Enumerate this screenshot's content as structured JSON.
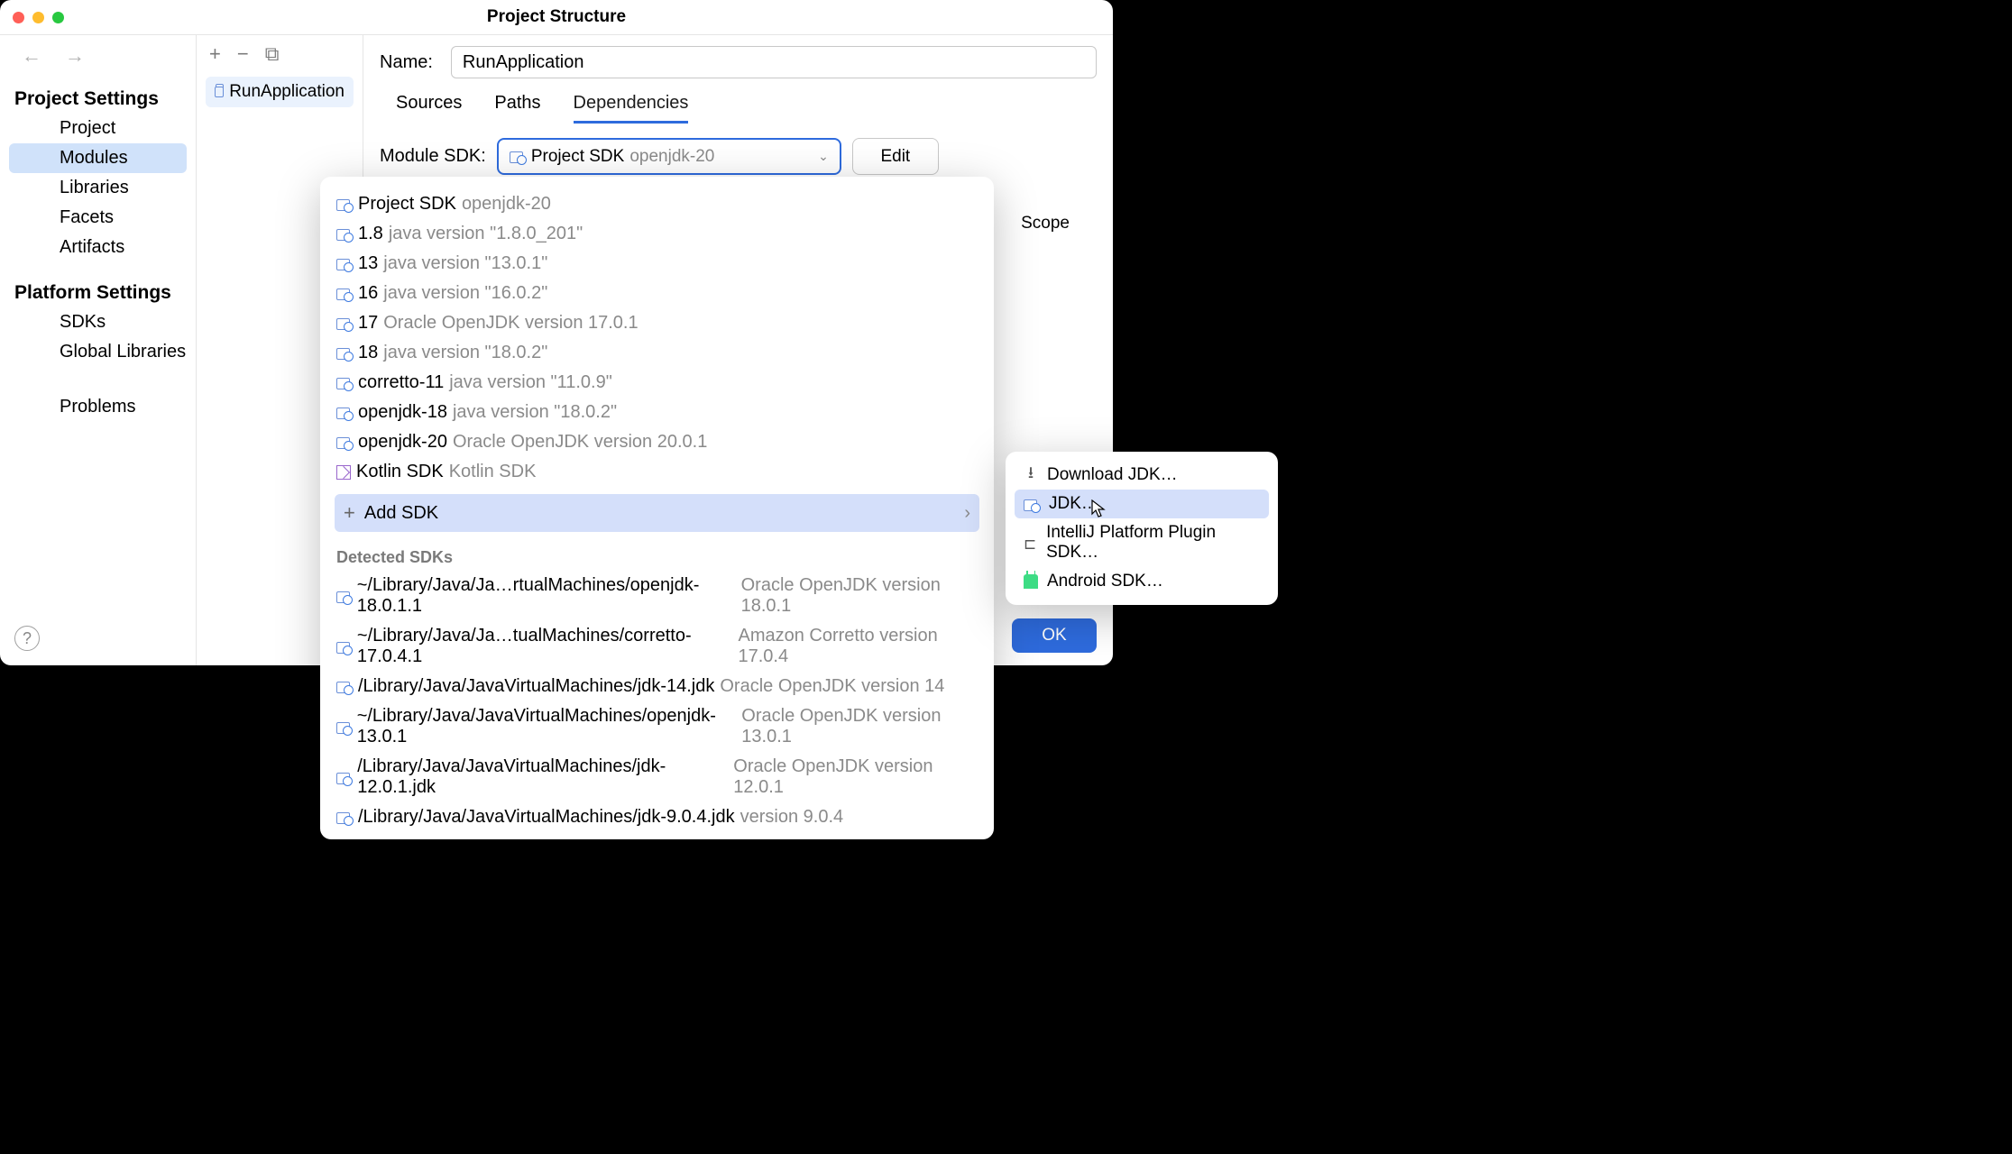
{
  "window": {
    "title": "Project Structure"
  },
  "sidebar": {
    "section1": "Project Settings",
    "items1": [
      "Project",
      "Modules",
      "Libraries",
      "Facets",
      "Artifacts"
    ],
    "active1": 1,
    "section2": "Platform Settings",
    "items2": [
      "SDKs",
      "Global Libraries"
    ],
    "section3": "",
    "items3": [
      "Problems"
    ]
  },
  "modules": {
    "selected": "RunApplication"
  },
  "form": {
    "name_label": "Name:",
    "name_value": "RunApplication",
    "tabs": [
      "Sources",
      "Paths",
      "Dependencies"
    ],
    "active_tab": 2,
    "sdk_label": "Module SDK:",
    "sdk_value_main": "Project SDK",
    "sdk_value_ver": "openjdk-20",
    "edit_label": "Edit",
    "scope_label": "Scope"
  },
  "dropdown": {
    "items": [
      {
        "name": "Project SDK",
        "ver": "openjdk-20",
        "icon": "sdk"
      },
      {
        "name": "1.8",
        "ver": "java version \"1.8.0_201\"",
        "icon": "sdk"
      },
      {
        "name": "13",
        "ver": "java version \"13.0.1\"",
        "icon": "sdk"
      },
      {
        "name": "16",
        "ver": "java version \"16.0.2\"",
        "icon": "sdk"
      },
      {
        "name": "17",
        "ver": "Oracle OpenJDK version 17.0.1",
        "icon": "sdk"
      },
      {
        "name": "18",
        "ver": "java version \"18.0.2\"",
        "icon": "sdk"
      },
      {
        "name": "corretto-11",
        "ver": "java version \"11.0.9\"",
        "icon": "sdk"
      },
      {
        "name": "openjdk-18",
        "ver": "java version \"18.0.2\"",
        "icon": "sdk"
      },
      {
        "name": "openjdk-20",
        "ver": "Oracle OpenJDK version 20.0.1",
        "icon": "sdk"
      },
      {
        "name": "Kotlin SDK",
        "ver": "Kotlin SDK",
        "icon": "kotlin"
      }
    ],
    "add_sdk": "Add SDK",
    "detected_header": "Detected SDKs",
    "detected": [
      {
        "path": "~/Library/Java/Ja…rtualMachines/openjdk-18.0.1.1",
        "ver": "Oracle OpenJDK version 18.0.1"
      },
      {
        "path": "~/Library/Java/Ja…tualMachines/corretto-17.0.4.1",
        "ver": "Amazon Corretto version 17.0.4"
      },
      {
        "path": "/Library/Java/JavaVirtualMachines/jdk-14.jdk",
        "ver": "Oracle OpenJDK version 14"
      },
      {
        "path": "~/Library/Java/JavaVirtualMachines/openjdk-13.0.1",
        "ver": "Oracle OpenJDK version 13.0.1"
      },
      {
        "path": "/Library/Java/JavaVirtualMachines/jdk-12.0.1.jdk",
        "ver": "Oracle OpenJDK version 12.0.1"
      },
      {
        "path": "/Library/Java/JavaVirtualMachines/jdk-9.0.4.jdk",
        "ver": "version 9.0.4"
      }
    ]
  },
  "submenu": {
    "items": [
      {
        "label": "Download JDK…",
        "icon": "download"
      },
      {
        "label": "JDK…",
        "icon": "sdk",
        "active": true
      },
      {
        "label": "IntelliJ Platform Plugin SDK…",
        "icon": "plug"
      },
      {
        "label": "Android SDK…",
        "icon": "android"
      }
    ]
  },
  "footer": {
    "ok": "OK"
  }
}
